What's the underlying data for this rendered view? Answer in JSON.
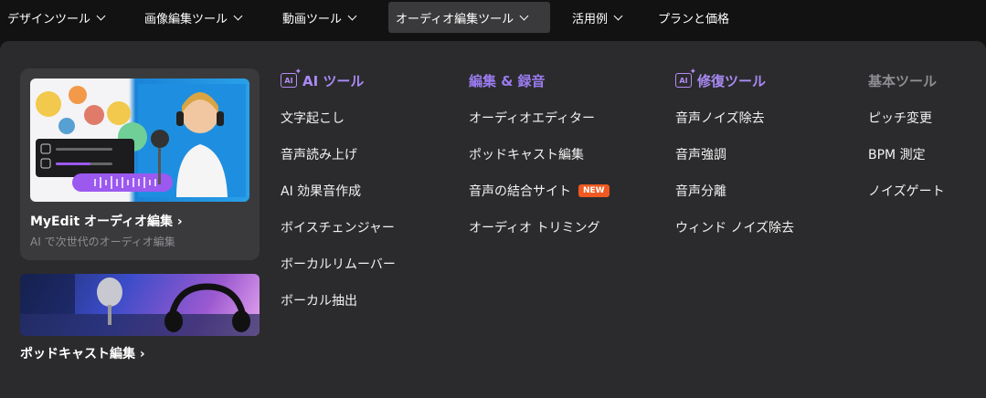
{
  "nav": {
    "items": [
      {
        "label": "デザインツール"
      },
      {
        "label": "画像編集ツール"
      },
      {
        "label": "動画ツール"
      },
      {
        "label": "オーディオ編集ツール"
      },
      {
        "label": "活用例"
      },
      {
        "label": "プランと価格"
      }
    ],
    "active_index": 3
  },
  "feature": {
    "title": "MyEdit オーディオ編集",
    "arrow": "›",
    "subtitle": "AI で次世代のオーディオ編集"
  },
  "podcast": {
    "title": "ポッドキャスト編集",
    "arrow": "›"
  },
  "columns": [
    {
      "heading": "AI ツール",
      "heading_color": "#b58cf5",
      "icon": "ai-sparkle-icon",
      "items": [
        "文字起こし",
        "音声読み上げ",
        "AI 効果音作成",
        "ボイスチェンジャー",
        "ボーカルリムーバー",
        "ボーカル抽出"
      ]
    },
    {
      "heading": "編集 & 録音",
      "heading_color": "#9b7bf0",
      "items": [
        "オーディオエディター",
        "ポッドキャスト編集",
        "音声の結合サイト",
        "オーディオ トリミング"
      ],
      "new_badge": "NEW"
    },
    {
      "heading": "修復ツール",
      "heading_color": "#a98af5",
      "icon": "ai-sparkle-icon",
      "items": [
        "音声ノイズ除去",
        "音声強調",
        "音声分離",
        "ウィンド ノイズ除去"
      ]
    },
    {
      "heading": "基本ツール",
      "heading_color": "#8e8e93",
      "items": [
        "ピッチ変更",
        "BPM 測定",
        "ノイズゲート"
      ]
    }
  ],
  "colors": {
    "background": "#121212",
    "panel": "#2b2b2d",
    "accent": "#b58cf5",
    "new_badge": "#f05a22"
  }
}
